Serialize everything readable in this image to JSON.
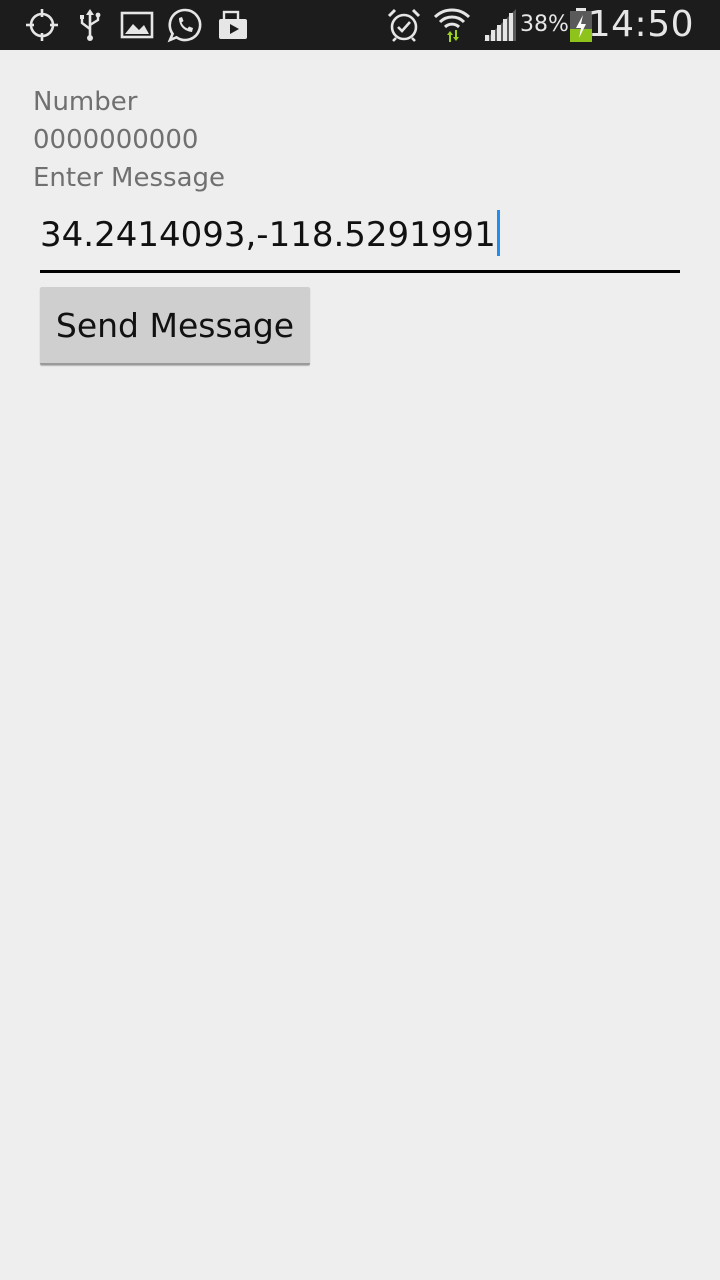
{
  "status_bar": {
    "left_icons": [
      "gps-icon",
      "usb-icon",
      "gallery-icon",
      "whatsapp-icon",
      "media-upload-icon"
    ],
    "right_icons": [
      "alarm-icon",
      "wifi-icon",
      "signal-icon",
      "battery-icon"
    ],
    "battery_percent": "38%",
    "time": "14:50",
    "colors": {
      "background": "#1c1c1c",
      "icon": "#e6e6e6",
      "wifi_arrows": "#9bd21c",
      "battery_charge": "#8ec31c"
    }
  },
  "form": {
    "number_label": "Number",
    "number_value": "0000000000",
    "message_label": "Enter Message",
    "message_value": "34.2414093,-118.5291991",
    "send_button_label": "Send Message"
  },
  "colors": {
    "background": "#eeeeee",
    "label_text": "#707070",
    "caret": "#1f8ef1",
    "button_bg": "#cfcfcf"
  }
}
